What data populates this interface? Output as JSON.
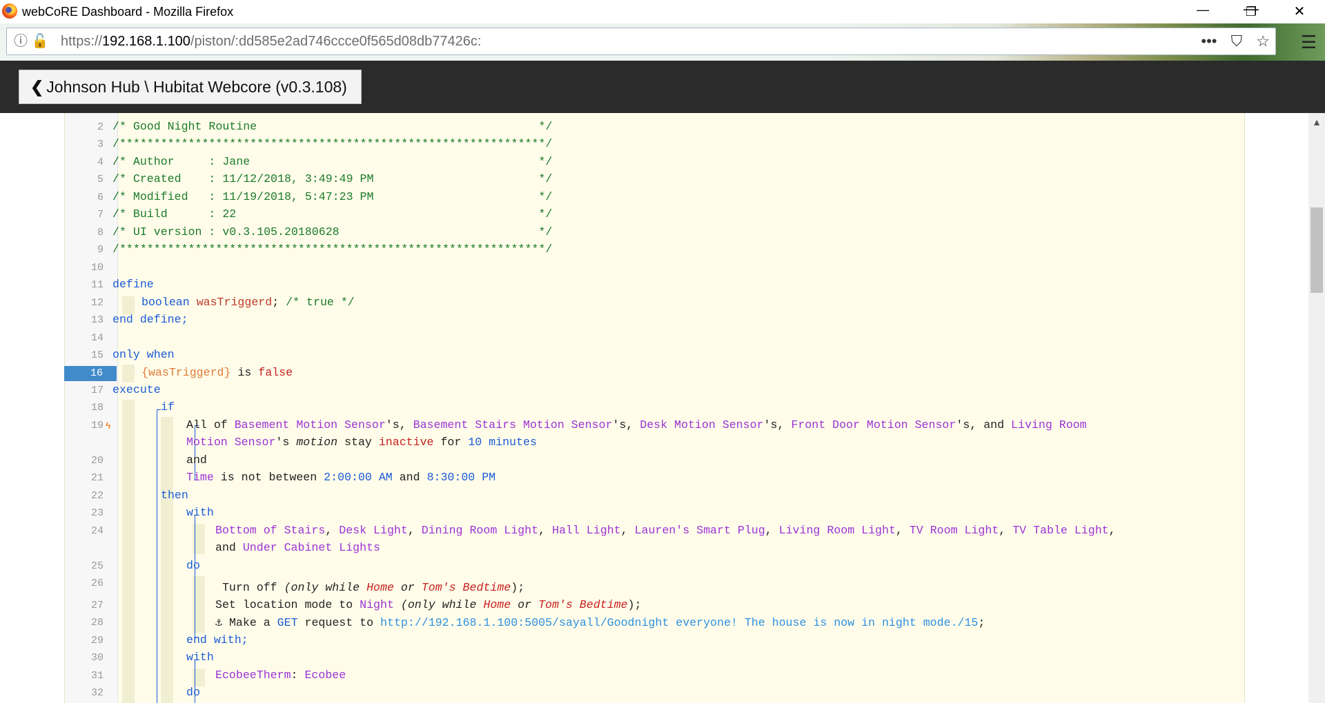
{
  "window": {
    "title": "webCoRE Dashboard - Mozilla Firefox",
    "minimize": "—",
    "restore": "❐",
    "close": "✕"
  },
  "browser": {
    "url_scheme": "https://",
    "url_host": "192.168.1.100",
    "url_path": "/piston/:dd585e2ad746ccce0f565d08db77426c:",
    "more_icon": "•••",
    "pocket_icon": "⛉",
    "bookmark_icon": "☆",
    "menu_icon": "☰"
  },
  "header": {
    "back_chevron": "❮",
    "back_label": "Johnson Hub \\ Hubitat Webcore (v0.3.108)"
  },
  "code": {
    "active_line": "16",
    "lines": {
      "l2": "/* Good Night Routine                                         */",
      "l3": "/**************************************************************/",
      "l4": "/* Author     : Jane                                          */",
      "l5": "/* Created    : 11/12/2018, 3:49:49 PM                        */",
      "l6": "/* Modified   : 11/19/2018, 5:47:23 PM                        */",
      "l7": "/* Build      : 22                                            */",
      "l8": "/* UI version : v0.3.105.20180628                             */",
      "l9": "/**************************************************************/",
      "l11": "define",
      "l12_type": "boolean",
      "l12_var": "wasTriggerd",
      "l12_semi": ";",
      "l12_cmt": " /* true */",
      "l13": "end define;",
      "l15": "only when",
      "l16_var": "{wasTriggerd}",
      "l16_is": " is ",
      "l16_val": "false",
      "l17": "execute",
      "l18": "if",
      "l19_all": "All of ",
      "l19_d1": "Basement Motion Sensor",
      "l19_s1": "'s, ",
      "l19_d2": "Basement Stairs Motion Sensor",
      "l19_s2": "'s, ",
      "l19_d3": "Desk Motion Sensor",
      "l19_s3": "'s, ",
      "l19_d4": "Front Door Motion Sensor",
      "l19_s4": "'s, and ",
      "l19_d5": "Living Room",
      "l19b_d5": "Motion Sensor",
      "l19b_s": "'s ",
      "l19b_attr": "motion",
      "l19b_stay": " stay ",
      "l19b_val": "inactive",
      "l19b_for": " for ",
      "l19b_num": "10 minutes",
      "l20": "and",
      "l21_time": "Time",
      "l21_is": " is not between ",
      "l21_t1": "2:00:00 AM",
      "l21_and": " and ",
      "l21_t2": "8:30:00 PM",
      "l22": "then",
      "l23": "with",
      "l24_d1": "Bottom of Stairs",
      "l24_d2": "Desk Light",
      "l24_d3": "Dining Room Light",
      "l24_d4": "Hall Light",
      "l24_d5": "Lauren's Smart Plug",
      "l24_d6": "Living Room Light",
      "l24_d7": "TV Room Light",
      "l24_d8": "TV Table Light",
      "l24b_and": "and ",
      "l24b_d9": "Under Cabinet Lights",
      "comma": ", ",
      "comma_end": ",",
      "l25": "do",
      "l26_a": " Turn off ",
      "l26_b": "(only while ",
      "l26_c": "Home",
      "l26_d": " or ",
      "l26_e": "Tom's Bedtime",
      "l26_f": ");",
      "l27_a": "Set location mode to ",
      "l27_b": "Night",
      "l27_c": " (only while ",
      "l27_d": "Home",
      "l27_e": " or ",
      "l27_f": "Tom's Bedtime",
      "l27_g": ");",
      "l28_anchor": "⚓",
      "l28_a": " Make a ",
      "l28_b": "GET",
      "l28_c": " request to ",
      "l28_d": "http://192.168.1.100:5005/sayall/Goodnight everyone! The house is now in night mode./15",
      "l28_e": ";",
      "l29": "end with;",
      "l30": "with",
      "l31_a": "EcobeeTherm",
      "l31_b": ": ",
      "l31_c": "Ecobee",
      "l32": "do"
    }
  }
}
